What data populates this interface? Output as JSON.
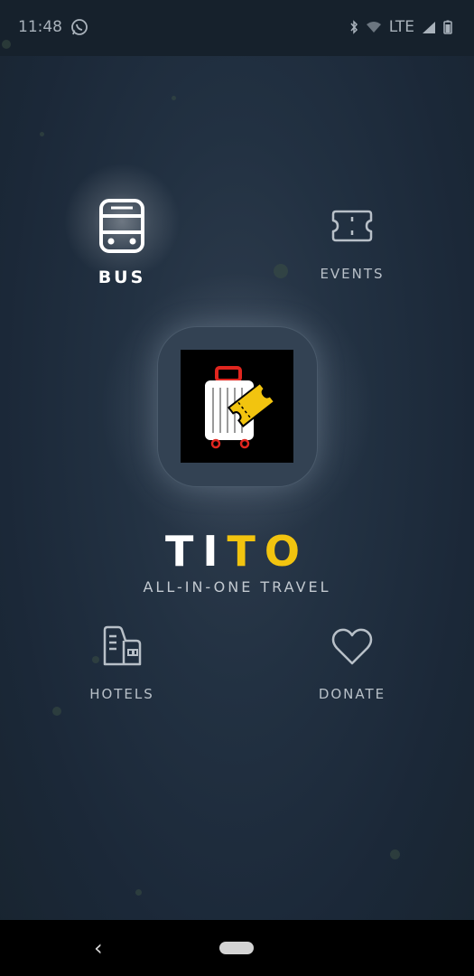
{
  "status_bar": {
    "time": "11:48",
    "network": "LTE"
  },
  "menu": {
    "bus": {
      "label": "BUS",
      "icon": "bus-icon"
    },
    "events": {
      "label": "EVENTS",
      "icon": "ticket-icon"
    },
    "hotels": {
      "label": "HOTELS",
      "icon": "hotel-building-icon"
    },
    "donate": {
      "label": "DONATE",
      "icon": "heart-icon"
    }
  },
  "brand": {
    "name_white": "TI",
    "name_yellow": "TO",
    "tagline": "ALL-IN-ONE TRAVEL"
  },
  "colors": {
    "background": "#1b2838",
    "accent_yellow": "#f2c40f",
    "logo_red": "#e0261f"
  }
}
